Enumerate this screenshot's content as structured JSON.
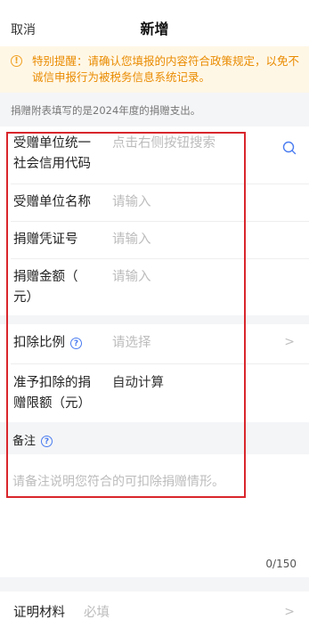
{
  "header": {
    "cancel_label": "取消",
    "title": "新增"
  },
  "notice": {
    "icon": "info-icon",
    "text": "特别提醒：请确认您填报的内容符合政策规定，以免不诚信申报行为被税务信息系统记录。",
    "color": "#e98b00"
  },
  "note": "捐赠附表填写的是2024年度的捐赠支出。",
  "form": {
    "credit_code_label_1": "受赠单位统一",
    "credit_code_label_2": "社会信用代码",
    "credit_code_placeholder": "点击右侧按钮搜索",
    "unit_name_label": "受赠单位名称",
    "unit_name_placeholder": "请输入",
    "voucher_label": "捐赠凭证号",
    "voucher_placeholder": "请输入",
    "amount_label_1": "捐赠金额（",
    "amount_label_2": "元）",
    "amount_placeholder": "请输入",
    "ratio_label": "扣除比例",
    "ratio_placeholder": "请选择",
    "limit_label_1": "准予扣除的捐",
    "limit_label_2": "赠限额（元）",
    "limit_value": "自动计算"
  },
  "remark": {
    "label": "备注",
    "placeholder": "请备注说明您符合的可扣除捐赠情形。",
    "counter": "0/150"
  },
  "proof": {
    "label": "证明材料",
    "placeholder": "必填"
  },
  "colors": {
    "accent": "#4a7cf0",
    "highlight_box": "#d9262c"
  }
}
